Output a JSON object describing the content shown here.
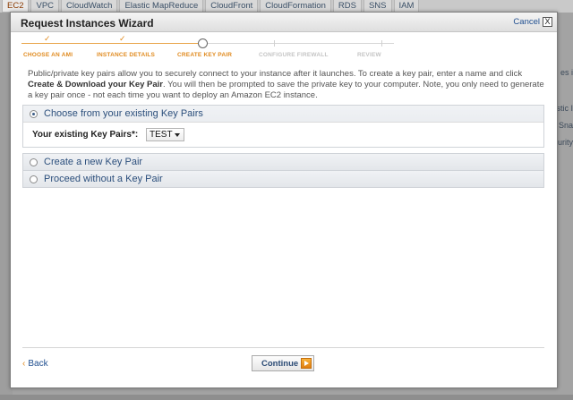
{
  "console": {
    "tabs": [
      "EC2",
      "VPC",
      "CloudWatch",
      "Elastic MapReduce",
      "CloudFront",
      "CloudFormation",
      "RDS",
      "SNS",
      "IAM"
    ],
    "active_tab": "EC2",
    "right_fragments": [
      "es i",
      "stic I",
      "Sna",
      "urity"
    ]
  },
  "wizard": {
    "title": "Request Instances Wizard",
    "cancel_label": "Cancel",
    "close_glyph": "X",
    "steps": [
      {
        "label": "CHOOSE AN AMI",
        "state": "done"
      },
      {
        "label": "INSTANCE DETAILS",
        "state": "done"
      },
      {
        "label": "CREATE KEY PAIR",
        "state": "current"
      },
      {
        "label": "CONFIGURE FIREWALL",
        "state": "todo"
      },
      {
        "label": "REVIEW",
        "state": "todo"
      }
    ],
    "check_glyph": "✓",
    "intro_1": "Public/private key pairs allow you to securely connect to your instance after it launches. To create a key pair, enter a name and click ",
    "intro_bold": "Create & Download your Key Pair",
    "intro_2": ". You will then be prompted to save the private key to your computer. Note, you only need to generate a key pair once - not each time you want to deploy an Amazon EC2 instance.",
    "options": [
      {
        "label": "Choose from your existing Key Pairs",
        "selected": true
      },
      {
        "label": "Create a new Key Pair",
        "selected": false
      },
      {
        "label": "Proceed without a Key Pair",
        "selected": false
      }
    ],
    "existing_label": "Your existing Key Pairs*:",
    "existing_value": "TEST",
    "back_label": "Back",
    "back_glyph": "‹",
    "continue_label": "Continue"
  },
  "colors": {
    "accent_orange": "#e08a1e",
    "link_blue": "#1f4e8f",
    "option_text": "#2c4f7c"
  }
}
